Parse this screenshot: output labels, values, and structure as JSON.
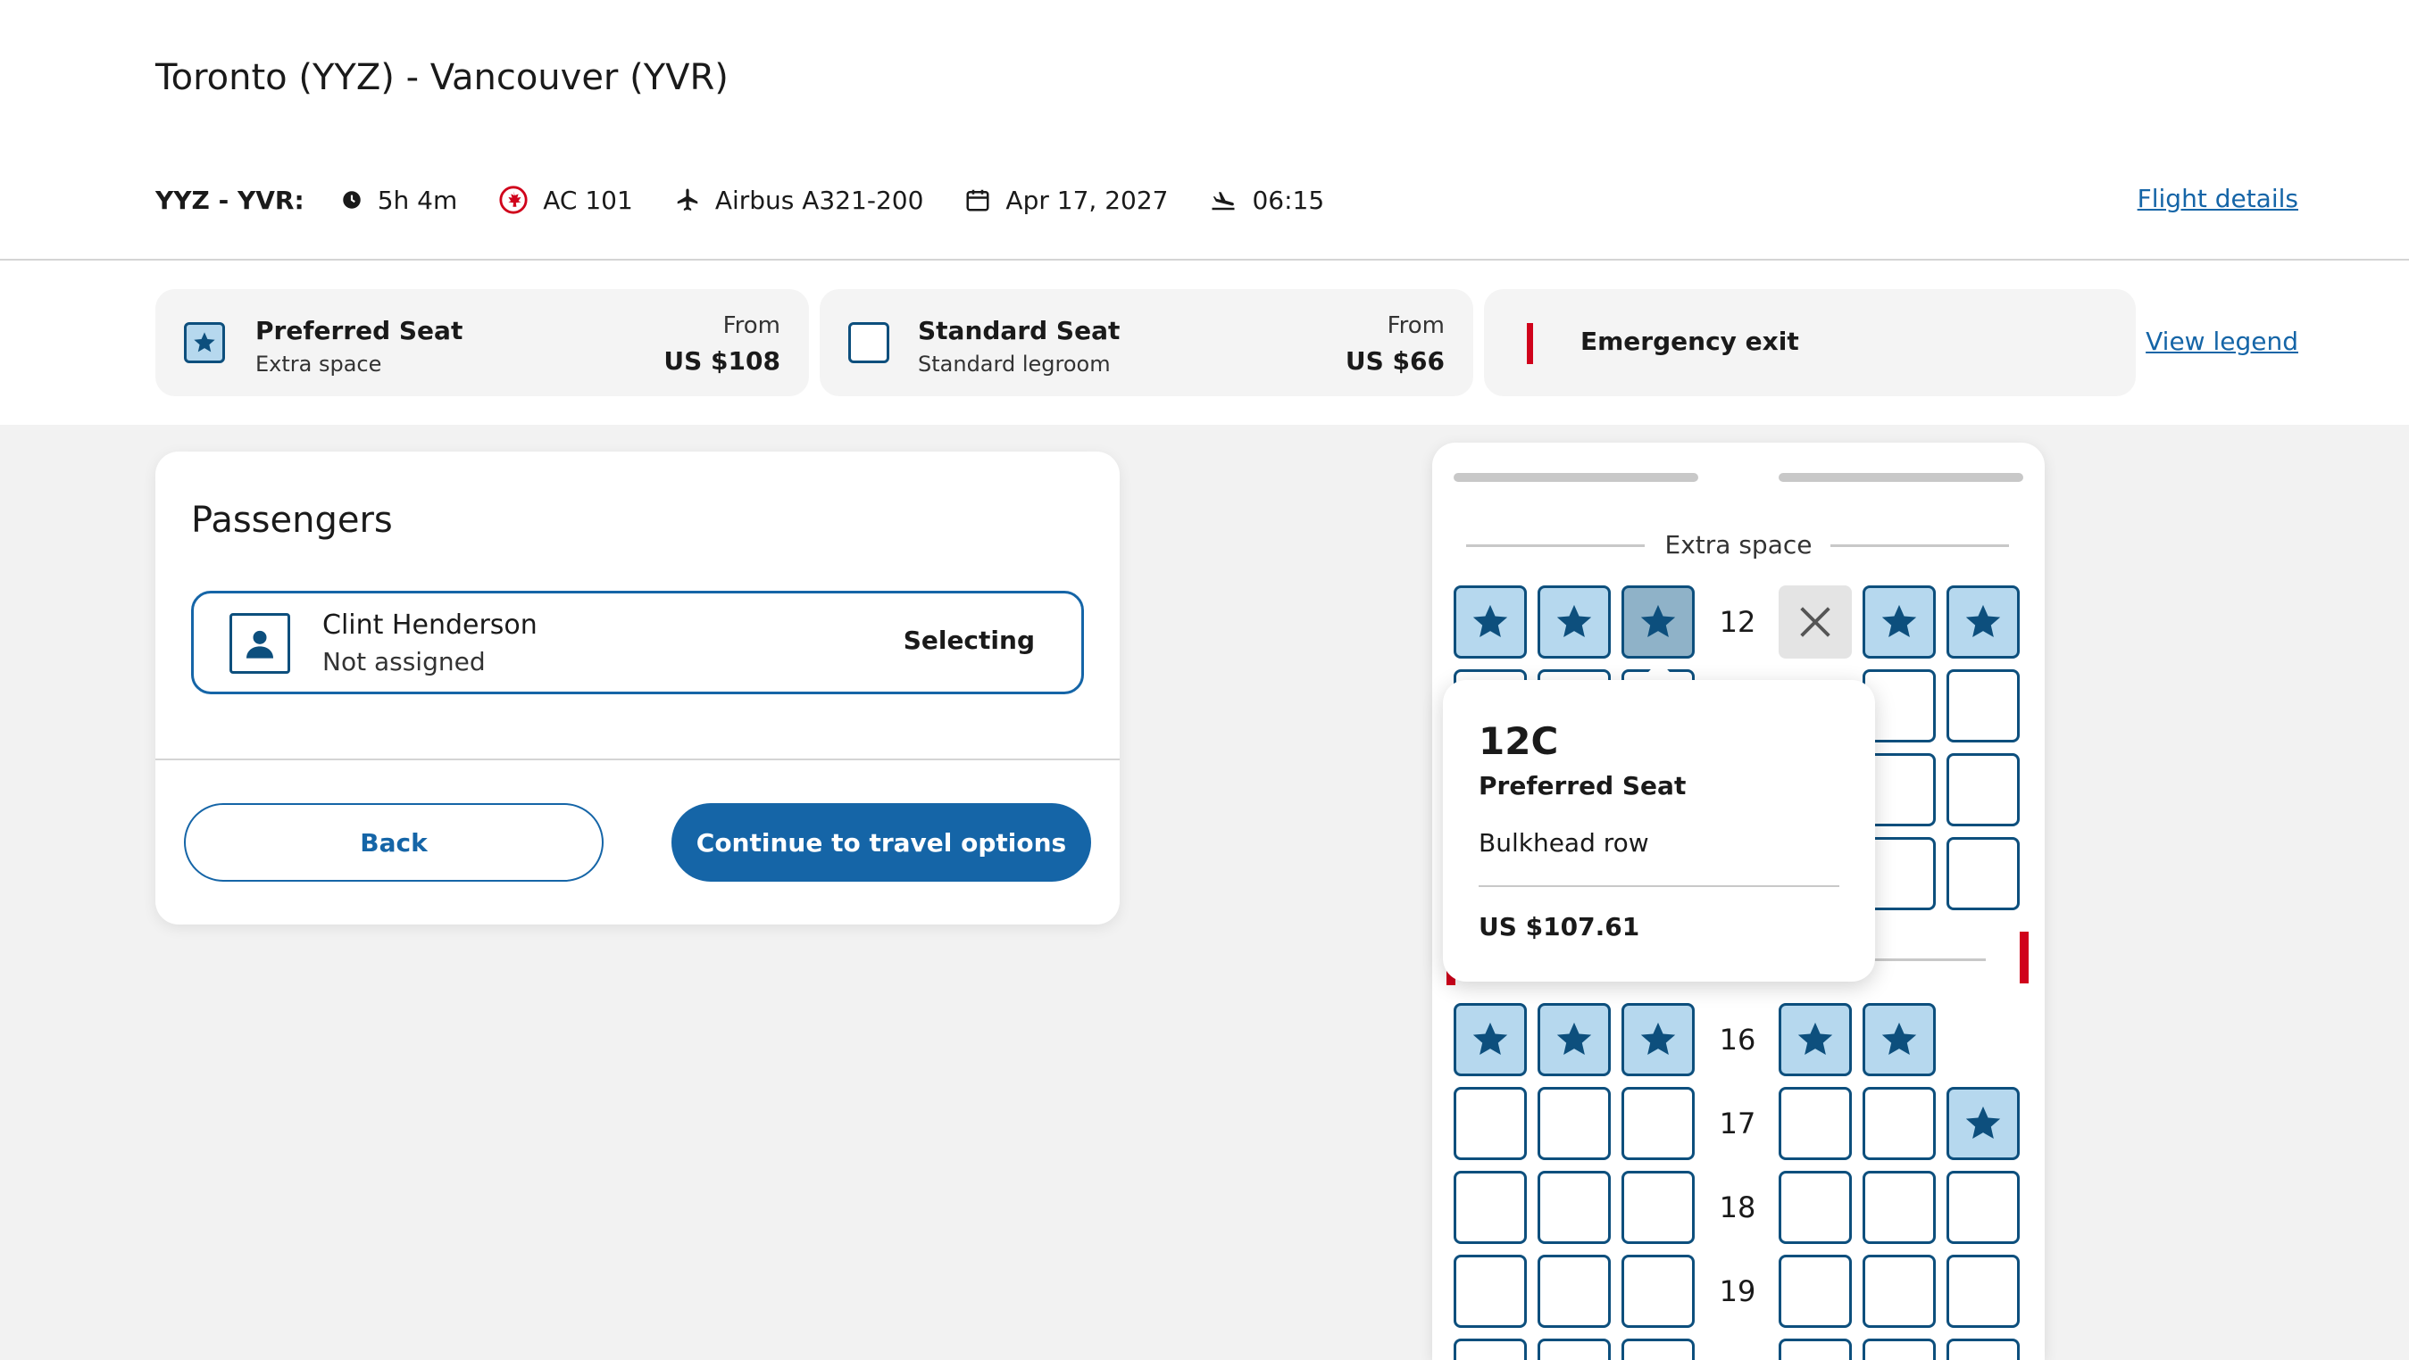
{
  "header": {
    "title": "Toronto (YYZ) - Vancouver (YVR)",
    "route_code": "YYZ - YVR:",
    "duration": "5h 4m",
    "flight_number": "AC 101",
    "aircraft": "Airbus A321-200",
    "date": "Apr 17, 2027",
    "departure_time": "06:15",
    "flight_details_link": "Flight details"
  },
  "legend": {
    "preferred": {
      "title": "Preferred Seat",
      "subtitle": "Extra space",
      "from_label": "From",
      "price": "US $108"
    },
    "standard": {
      "title": "Standard Seat",
      "subtitle": "Standard legroom",
      "from_label": "From",
      "price": "US $66"
    },
    "emergency": {
      "title": "Emergency exit"
    },
    "view_legend_link": "View legend"
  },
  "passengers": {
    "heading": "Passengers",
    "items": [
      {
        "name": "Clint Henderson",
        "status": "Not assigned",
        "state": "Selecting"
      }
    ],
    "back_label": "Back",
    "continue_label": "Continue to travel options"
  },
  "seatmap": {
    "cabin_label": "Extra space",
    "rows": [
      "12",
      "16",
      "17",
      "18",
      "19"
    ]
  },
  "tooltip": {
    "seat": "12C",
    "type": "Preferred Seat",
    "note": "Bulkhead row",
    "price": "US $107.61"
  },
  "colors": {
    "brand_blue": "#1565a7",
    "seat_border": "#0d4f7d",
    "preferred_fill": "#b6d8ee",
    "exit_red": "#d0021b"
  }
}
